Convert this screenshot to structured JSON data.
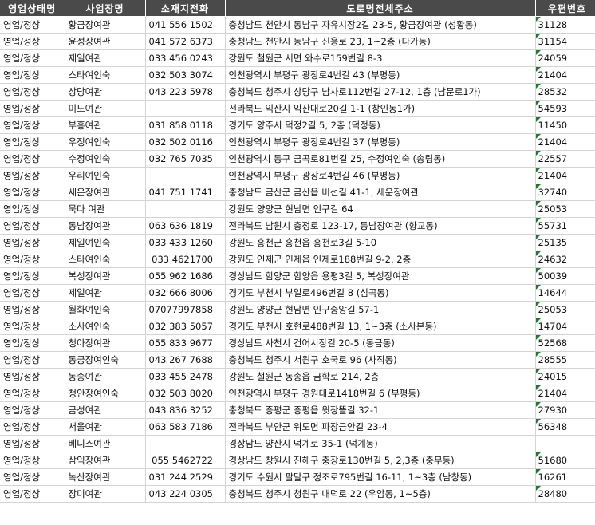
{
  "headers": [
    "영업상태명",
    "사업장명",
    "소재지전화",
    "도로명전체주소",
    "우편번호"
  ],
  "rows": [
    {
      "status": "영업/정상",
      "name": "황금장여관",
      "phone": "041 556 1502",
      "address": "충청남도 천안시 동남구 자유시장2길 23-5, 황금장여관 (성황동)",
      "zip": "31128"
    },
    {
      "status": "영업/정상",
      "name": "윤성장여관",
      "phone": "041 572 6373",
      "address": "충청남도 천안시 동남구 신용로 23, 1~2층 (다가동)",
      "zip": "31154"
    },
    {
      "status": "영업/정상",
      "name": "제일여관",
      "phone": "033 456 0243",
      "address": "강원도 철원군 서면 와수로159번길 8-3",
      "zip": "24059"
    },
    {
      "status": "영업/정상",
      "name": "스타여인숙",
      "phone": "032 503 3074",
      "address": "인천광역시 부평구 광장로4번길 43 (부평동)",
      "zip": "21404"
    },
    {
      "status": "영업/정상",
      "name": "상당여관",
      "phone": "043 223 5978",
      "address": "충청북도 청주시 상당구 남사로112번길 27-12, 1층 (남문로1가)",
      "zip": "28532"
    },
    {
      "status": "영업/정상",
      "name": "미도여관",
      "phone": "",
      "address": "전라북도 익산시 익산대로20길 1-1 (창인동1가)",
      "zip": "54593"
    },
    {
      "status": "영업/정상",
      "name": "부흥여관",
      "phone": "031 858 0118",
      "address": "경기도 양주시 덕정2길 5, 2층 (덕정동)",
      "zip": "11450"
    },
    {
      "status": "영업/정상",
      "name": "우정여인숙",
      "phone": "032 502 0116",
      "address": "인천광역시 부평구 광장로4번길 37 (부평동)",
      "zip": "21404"
    },
    {
      "status": "영업/정상",
      "name": "수정여인숙",
      "phone": "032 765 7035",
      "address": "인천광역시 동구 금곡로81번길 25, 수정여인숙 (송림동)",
      "zip": "22557"
    },
    {
      "status": "영업/정상",
      "name": "우리여인숙",
      "phone": "",
      "address": "인천광역시 부평구 광장로4번길 46 (부평동)",
      "zip": "21404"
    },
    {
      "status": "영업/정상",
      "name": "세운장여관",
      "phone": "041 751 1741",
      "address": "충청남도 금산군 금산읍 비선길 41-1, 세운장여관",
      "zip": "32740"
    },
    {
      "status": "영업/정상",
      "name": "묵다 여관",
      "phone": "",
      "address": "강원도 양양군 현남면 인구길 64",
      "zip": "25053"
    },
    {
      "status": "영업/정상",
      "name": "동남장여관",
      "phone": "063 636 1819",
      "address": "전라북도 남원시 충정로 123-17, 동남장여관 (향교동)",
      "zip": "55731"
    },
    {
      "status": "영업/정상",
      "name": "제일여인숙",
      "phone": "033 433 1260",
      "address": "강원도 홍천군 홍천읍 홍천로3길 5-10",
      "zip": "25135"
    },
    {
      "status": "영업/정상",
      "name": "스타여인숙",
      "phone": " 033 4621700",
      "address": "강원도 인제군 인제읍 인제로188번길 9-2, 2층",
      "zip": "24632"
    },
    {
      "status": "영업/정상",
      "name": "복성장여관",
      "phone": "055 962 1686",
      "address": "경상남도 함양군 함양읍 용평3길 5, 복성장여관",
      "zip": "50039"
    },
    {
      "status": "영업/정상",
      "name": "제일여관",
      "phone": "032 666 8006",
      "address": "경기도 부천시 부일로496번길 8 (심곡동)",
      "zip": "14644"
    },
    {
      "status": "영업/정상",
      "name": "월화여인숙",
      "phone": "07077997858",
      "address": "강원도 양양군 현남면 인구중앙길 57-1",
      "zip": "25053"
    },
    {
      "status": "영업/정상",
      "name": "소사여인숙",
      "phone": "032 383 5057",
      "address": "경기도 부천시 호현로488번길 13, 1~3층 (소사본동)",
      "zip": "14704"
    },
    {
      "status": "영업/정상",
      "name": "청아장여관",
      "phone": "055 833 9677",
      "address": "경상남도 사천시 건어시장길 20-5 (동금동)",
      "zip": "52568"
    },
    {
      "status": "영업/정상",
      "name": "동궁장여인숙",
      "phone": "043 267 7688",
      "address": "충청북도 청주시 서원구 호국로 96 (사직동)",
      "zip": "28555"
    },
    {
      "status": "영업/정상",
      "name": "동송여관",
      "phone": "033 455 2478",
      "address": "강원도 철원군 동송읍 금학로 214, 2층",
      "zip": "24015"
    },
    {
      "status": "영업/정상",
      "name": "청안장여인숙",
      "phone": "032 503 8020",
      "address": "인천광역시 부평구 경원대로1418번길 6 (부평동)",
      "zip": "21404"
    },
    {
      "status": "영업/정상",
      "name": "금성여관",
      "phone": "043 836 3252",
      "address": "충청북도 증평군 증평읍 윗장뜰길 32-1",
      "zip": "27930"
    },
    {
      "status": "영업/정상",
      "name": "서울여관",
      "phone": "063 583 7186",
      "address": "전라북도 부안군 위도면 파장금안길 23-4",
      "zip": "56348"
    },
    {
      "status": "영업/정상",
      "name": "베니스여관",
      "phone": "",
      "address": "경상남도 양산시 덕계로 35-1 (덕계동)",
      "zip": ""
    },
    {
      "status": "영업/정상",
      "name": "삼익장여관",
      "phone": " 055 5462722",
      "address": "경상남도 창원시 진해구 충장로130번길 5, 2,3층 (충무동)",
      "zip": "51680"
    },
    {
      "status": "영업/정상",
      "name": "녹산장여관",
      "phone": "031 244 2529",
      "address": "경기도 수원시 팔달구 정조로795번길 16-11, 1~3층 (남창동)",
      "zip": "16261"
    },
    {
      "status": "영업/정상",
      "name": "장미여관",
      "phone": "043 224 0305",
      "address": "충청북도 청주시 청원구 내덕로 22 (우암동, 1~5층)",
      "zip": "28480"
    }
  ],
  "colors": {
    "header_bg": "#4a4a4a",
    "header_text": "#ffffff",
    "gridline": "#d4d4d4",
    "marker": "#1d7a2e"
  }
}
